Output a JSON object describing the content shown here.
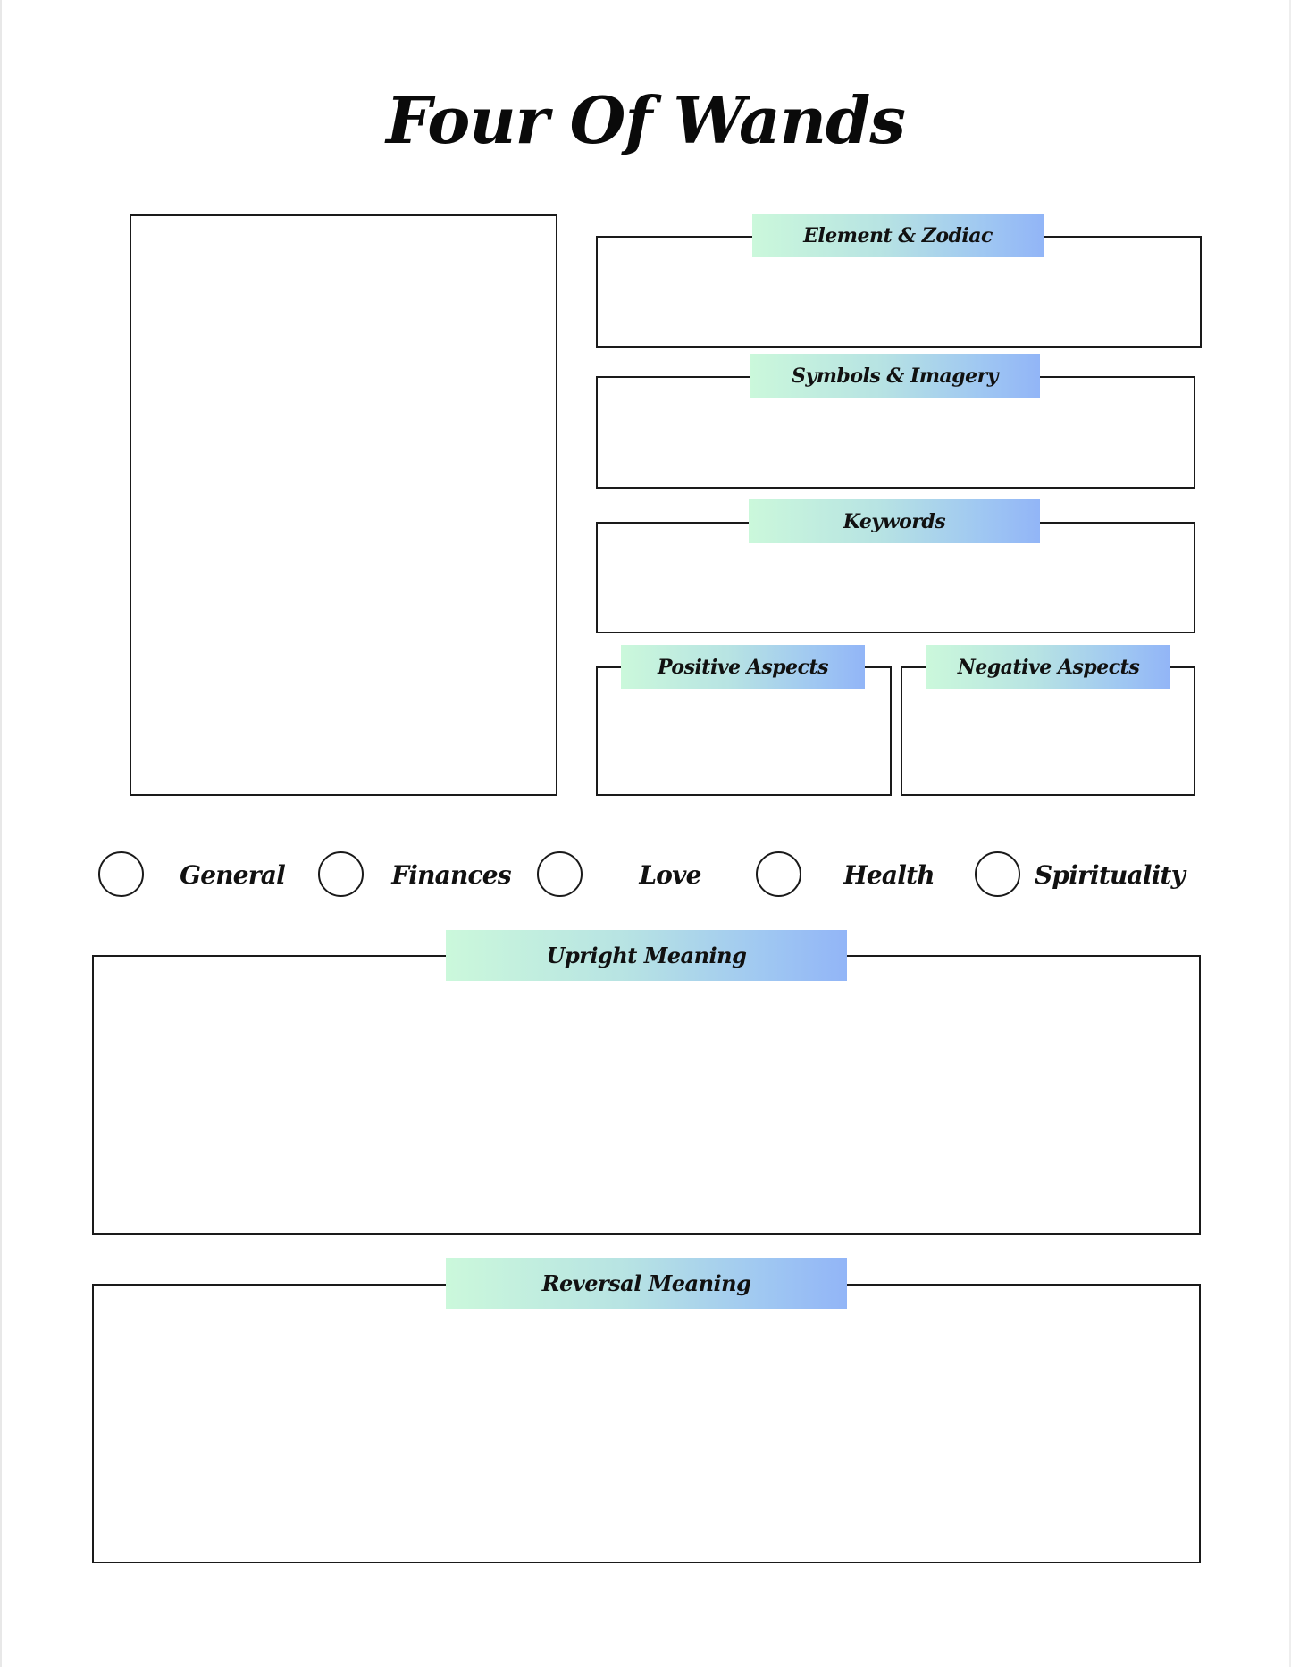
{
  "title": "Four Of Wands",
  "theme": {
    "label_gradient_start": "#cbf8db",
    "label_gradient_end": "#92b5f7",
    "border_color": "#1a1a1a"
  },
  "card_image": {
    "placeholder": ""
  },
  "sections": {
    "element_zodiac": {
      "label": "Element & Zodiac",
      "value": ""
    },
    "symbols_imagery": {
      "label": "Symbols & Imagery",
      "value": ""
    },
    "keywords": {
      "label": "Keywords",
      "value": ""
    },
    "positive_aspects": {
      "label": "Positive Aspects",
      "value": ""
    },
    "negative_aspects": {
      "label": "Negative Aspects",
      "value": ""
    },
    "upright_meaning": {
      "label": "Upright Meaning",
      "value": ""
    },
    "reversal_meaning": {
      "label": "Reversal Meaning",
      "value": ""
    }
  },
  "categories": [
    {
      "label": "General",
      "checked": false
    },
    {
      "label": "Finances",
      "checked": false
    },
    {
      "label": "Love",
      "checked": false
    },
    {
      "label": "Health",
      "checked": false
    },
    {
      "label": "Spirituality",
      "checked": false
    }
  ]
}
